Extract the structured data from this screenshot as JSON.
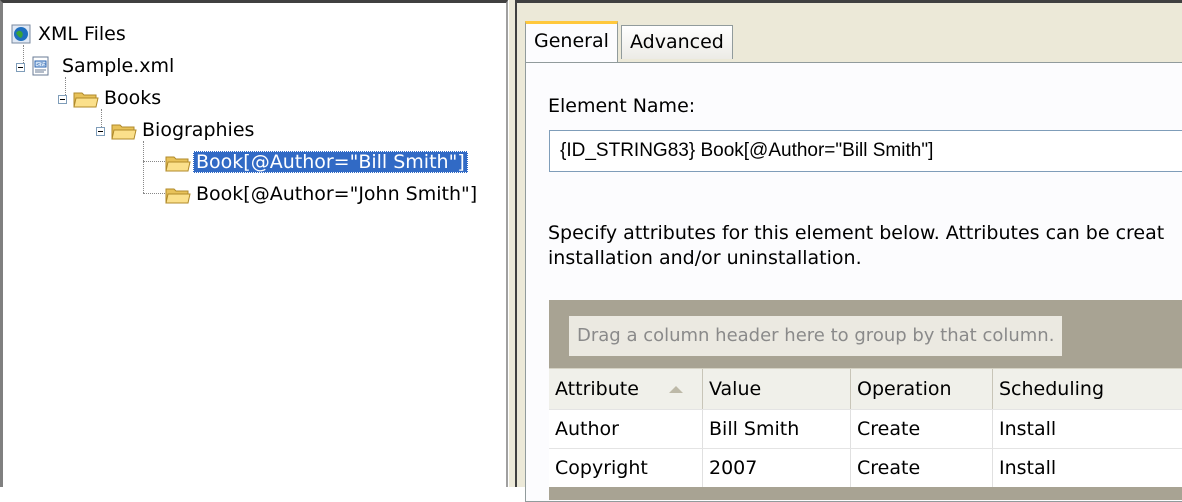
{
  "tree": {
    "root_label": "XML Files",
    "file_label": "Sample.xml",
    "books_label": "Books",
    "biographies_label": "Biographies",
    "selected_item_label": "Book[@Author=\"Bill Smith\"]",
    "other_item_label": "Book[@Author=\"John Smith\"]"
  },
  "tabs": [
    {
      "label": "General",
      "active": true
    },
    {
      "label": "Advanced",
      "active": false
    }
  ],
  "general": {
    "element_name_label": "Element Name:",
    "element_name_value": "{ID_STRING83} Book[@Author=\"Bill Smith\"]",
    "description_line1": "Specify attributes for this element below. Attributes can be creat",
    "description_line2": "installation and/or uninstallation."
  },
  "grid": {
    "group_panel_text": "Drag a column header here to group by that column.",
    "columns": [
      "Attribute",
      "Value",
      "Operation",
      "Scheduling"
    ],
    "sorted_column": "Attribute",
    "rows": [
      {
        "attribute": "Author",
        "value": "Bill Smith",
        "operation": "Create",
        "scheduling": "Install"
      },
      {
        "attribute": "Copyright",
        "value": "2007",
        "operation": "Create",
        "scheduling": "Install"
      }
    ]
  },
  "colors": {
    "selection": "#316ac5",
    "tab_highlight": "#ffc83c",
    "panel_background": "#ece9d8"
  }
}
